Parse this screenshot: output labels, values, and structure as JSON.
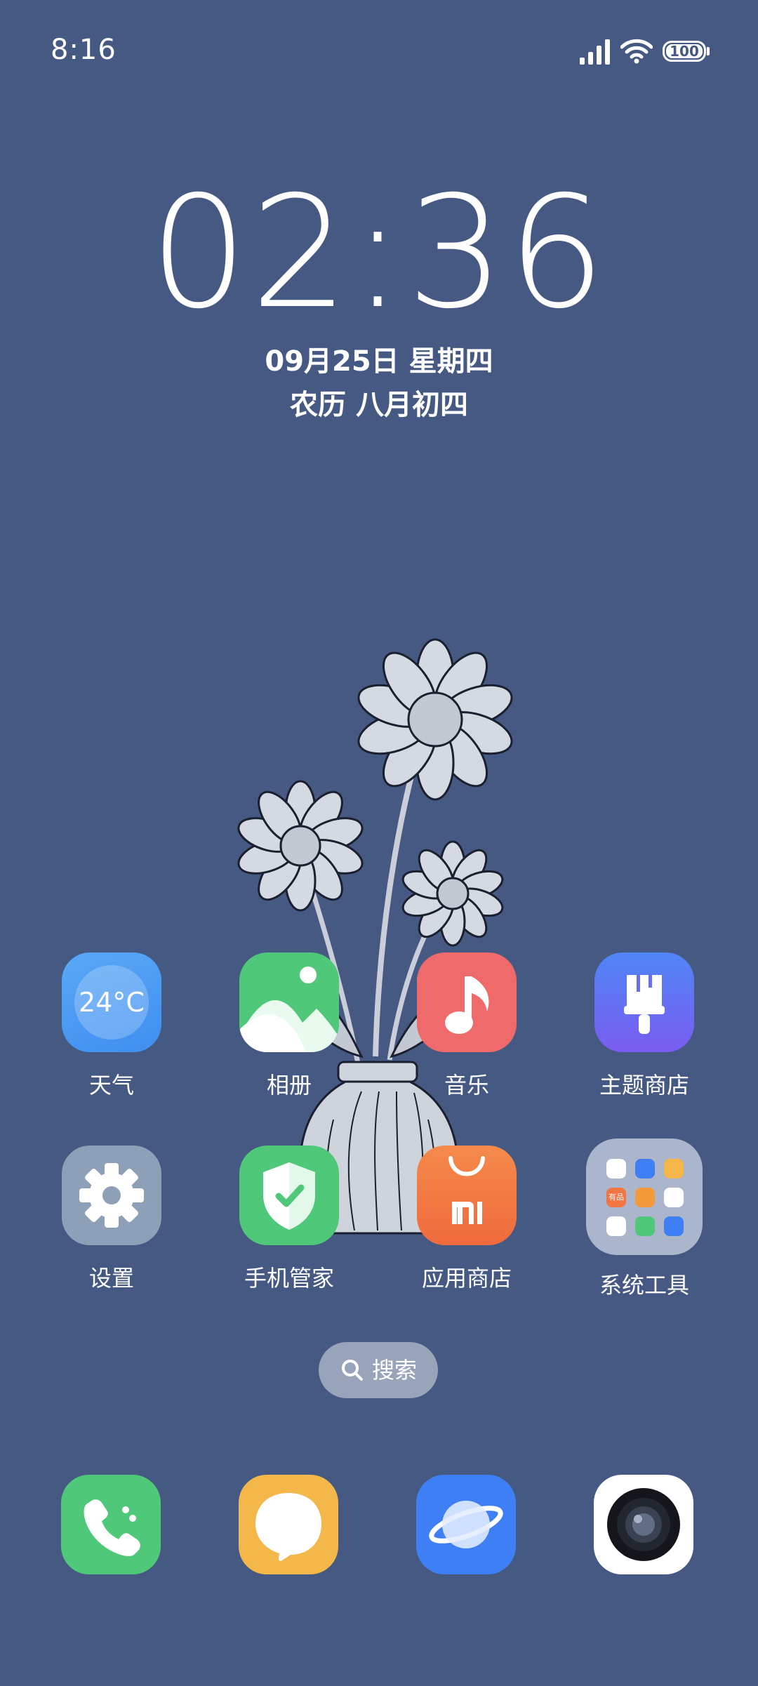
{
  "status_bar": {
    "time": "8:16",
    "battery_level": "100"
  },
  "clock_widget": {
    "time": "02:36",
    "date": "09月25日 星期四",
    "lunar": "农历 八月初四"
  },
  "apps": [
    {
      "label": "天气",
      "icon": "weather-icon",
      "icon_text": "24°C"
    },
    {
      "label": "相册",
      "icon": "gallery-icon"
    },
    {
      "label": "音乐",
      "icon": "music-icon"
    },
    {
      "label": "主题商店",
      "icon": "themes-icon"
    },
    {
      "label": "设置",
      "icon": "settings-icon"
    },
    {
      "label": "手机管家",
      "icon": "security-icon"
    },
    {
      "label": "应用商店",
      "icon": "app-store-icon"
    },
    {
      "label": "系统工具",
      "icon": "folder-icon"
    }
  ],
  "folder_mini_text": "有品",
  "search": {
    "label": "搜索"
  },
  "dock": [
    {
      "icon": "phone-icon"
    },
    {
      "icon": "messages-icon"
    },
    {
      "icon": "browser-icon"
    },
    {
      "icon": "camera-icon"
    }
  ],
  "colors": {
    "background": "#455983",
    "weather": "#4a9bf2",
    "gallery": "#4fc879",
    "music": "#ef6b6b",
    "themes": "#6a5ff0",
    "settings": "#8ea0b8",
    "security": "#4fc879",
    "app_store": "#f27543",
    "phone": "#4fc879",
    "messages": "#f4b74a",
    "browser": "#3f7ff5"
  }
}
